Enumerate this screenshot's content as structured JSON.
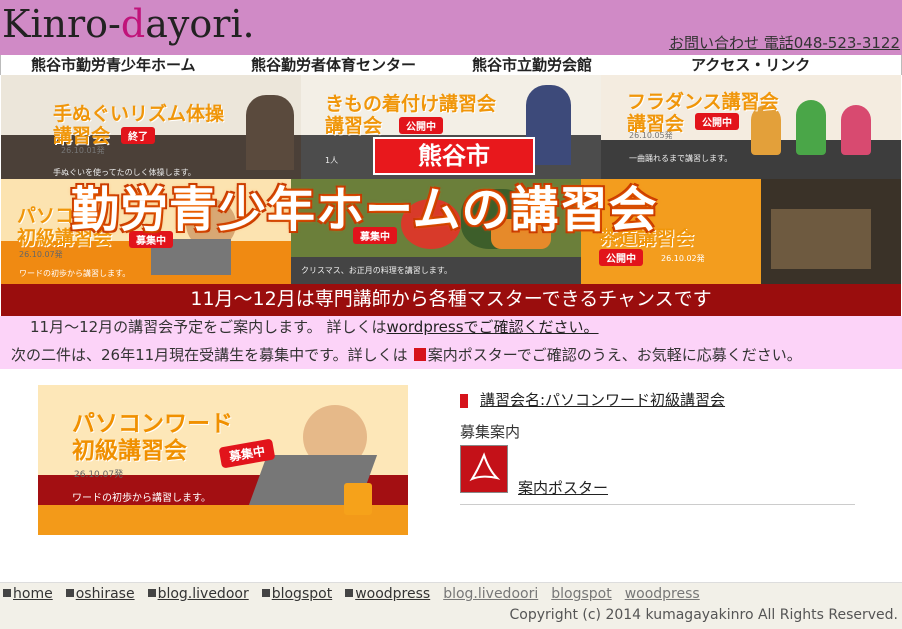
{
  "header": {
    "logo_part1": "Kinro-",
    "logo_highlight": "d",
    "logo_part2": "ayori.",
    "contact_text": "お問い合わせ 電話048-523-3122"
  },
  "nav": {
    "items": [
      {
        "label": "熊谷市勤労青少年ホーム"
      },
      {
        "label": "熊谷勤労者体育センター"
      },
      {
        "label": "熊谷市立勤労会館"
      },
      {
        "label": "アクセス・リンク"
      }
    ]
  },
  "banner": {
    "tiles": [
      {
        "title": "手ぬぐいリズム体操\n講習会",
        "badge": "終了",
        "date": "26.10.01発"
      },
      {
        "title": "きもの着付け講習会\n講習会",
        "badge": "公開中",
        "date": ""
      },
      {
        "title": "フラダンス講習会\n講習会",
        "badge": "公開中",
        "date": "26.10.05発"
      },
      {
        "title": "パソコン\n初級講習会",
        "badge": "募集中",
        "date": "26.10.07発"
      },
      {
        "title": "",
        "badge": "募集中",
        "date": ""
      },
      {
        "title": "茶道講習会",
        "badge": "公開中",
        "date": "26.10.02発"
      }
    ],
    "tile_subs": [
      "手ぬぐいを使ってたのしく体操します。",
      "1人",
      "一曲踊れるまで講習します。",
      "ワードの初歩から講習します。",
      "クリスマス、お正月の料理を講習します。"
    ],
    "city": "熊谷市",
    "headline": "勤労青少年ホームの講習会",
    "tagline": "11月～12月は専門講師から各種マスターできるチャンスです"
  },
  "notice": {
    "line1_text": "11月～12月の講習会予定をご案内します。 詳しくは",
    "line1_link": "wordpressでご確認ください。",
    "line2_before": "次の二件は、26年11月現在受講生を募集中です。詳しくは",
    "line2_after": "案内ポスターでご確認のうえ、お気軽に応募ください。"
  },
  "course": {
    "promo_title": "パソコンワード\n初級講習会",
    "promo_badge": "募集中",
    "promo_date": "26.10.07発",
    "promo_desc": "ワードの初歩から講習します。",
    "name_link": "講習会名:パソコンワード初級講習会",
    "recruit_label": "募集案内",
    "poster_link": "案内ポスター"
  },
  "footer": {
    "links_primary": [
      "home",
      "oshirase",
      "blog.livedoor",
      "blogspot",
      "woodpress"
    ],
    "links_secondary": [
      "blog.livedoori",
      "blogspot",
      "woodpress"
    ],
    "copyright": "Copyright (c) 2014 kumagayakinro All Rights Reserved."
  },
  "colors": {
    "header_bg": "#d08ac6",
    "notice_bg": "#fcd3f8",
    "accent_red": "#d6131b",
    "banner_bar": "#9a0d0d"
  },
  "icons": {
    "pdf": "pdf-icon",
    "marker": "red-marker-icon"
  }
}
